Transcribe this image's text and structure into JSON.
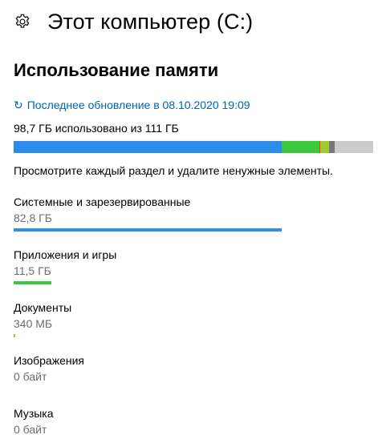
{
  "header": {
    "title": "Этот компьютер (C:)",
    "icon": "gear-icon"
  },
  "section": {
    "title": "Использование памяти"
  },
  "refresh": {
    "icon": "refresh-icon",
    "label": "Последнее обновление в 08.10.2020 19:09"
  },
  "usage": {
    "summary": "98,7 ГБ использовано из 111 ГБ",
    "used_gb": 98.7,
    "total_gb": 111,
    "segments": [
      {
        "category": "system",
        "fraction": 0.746,
        "color": "#2d8ceb"
      },
      {
        "category": "apps",
        "fraction": 0.104,
        "color": "#3cc83c"
      },
      {
        "category": "documents",
        "fraction": 0.003,
        "color": "#ff2d2d"
      },
      {
        "category": "other-green",
        "fraction": 0.024,
        "color": "#9ccd28"
      },
      {
        "category": "other-gray",
        "fraction": 0.016,
        "color": "#777777"
      }
    ],
    "free_color": "#cccccc"
  },
  "hint": "Просмотрите каждый раздел и удалите ненужные элементы.",
  "categories": [
    {
      "name": "Системные и зарезервированные",
      "size": "82,8 ГБ",
      "fraction": 0.746,
      "color": "#2d8ceb"
    },
    {
      "name": "Приложения и игры",
      "size": "11,5 ГБ",
      "fraction": 0.104,
      "color": "#3cc83c"
    },
    {
      "name": "Документы",
      "size": "340 МБ",
      "fraction": 0.003,
      "color": "#9ccd28"
    },
    {
      "name": "Изображения",
      "size": "0 байт",
      "fraction": 0,
      "color": "#d83b01"
    },
    {
      "name": "Музыка",
      "size": "0 байт",
      "fraction": 0,
      "color": "#ffb900"
    }
  ]
}
